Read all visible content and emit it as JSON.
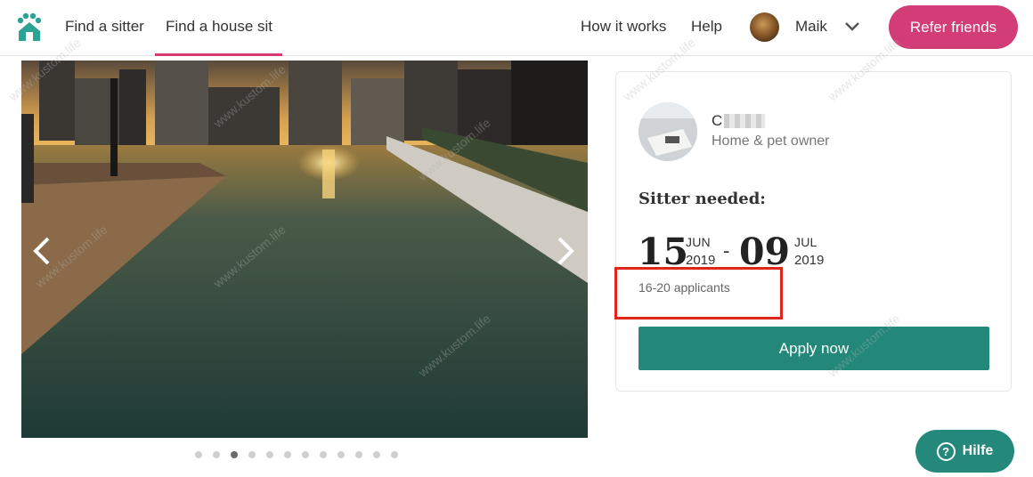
{
  "header": {
    "logo_icon": "paw-house-icon",
    "nav": [
      {
        "label": "Find a sitter"
      },
      {
        "label": "Find a house sit",
        "active": true
      }
    ],
    "right_nav": [
      {
        "label": "How it works"
      },
      {
        "label": "Help"
      }
    ],
    "user": {
      "name": "Maik",
      "avatar_icon": "user-avatar"
    },
    "refer_label": "Refer friends"
  },
  "gallery": {
    "slide_count": 12,
    "active_index": 2,
    "prev_icon": "chevron-left-icon",
    "next_icon": "chevron-right-icon"
  },
  "listing": {
    "owner_name": "C",
    "owner_role": "Home & pet owner",
    "heading": "Sitter needed:",
    "start": {
      "day": "15",
      "month": "JUN",
      "year": "2019"
    },
    "separator": "-",
    "end": {
      "day": "09",
      "month": "JUL",
      "year": "2019"
    },
    "applicants": "16-20 applicants",
    "apply_label": "Apply now"
  },
  "help_widget": {
    "label": "Hilfe",
    "icon_text": "?"
  },
  "watermark": "www.kustom.life",
  "colors": {
    "brand_pink": "#d23c77",
    "brand_teal": "#23877a",
    "highlight_red": "#e0251b"
  }
}
